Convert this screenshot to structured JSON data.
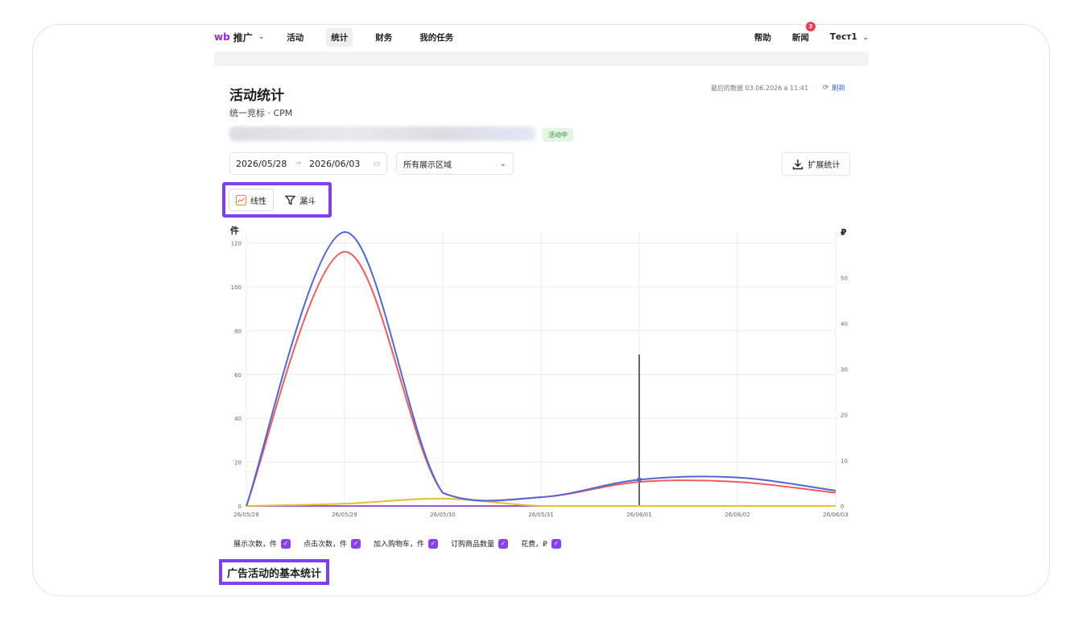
{
  "nav": {
    "logo": "wb",
    "product": "推广",
    "items": [
      "活动",
      "统计",
      "财务",
      "我的任务"
    ],
    "active_item": "统计",
    "help": "帮助",
    "news": "新闻",
    "news_badge": "3",
    "user": "Тест1"
  },
  "page": {
    "title": "活动统计",
    "subtitle": "统一竞标 · CPM",
    "updated": "最后的数据 03.06.2026 в 11:41",
    "refresh": "刷新",
    "status": "活动中"
  },
  "filters": {
    "date_from": "2026/05/28",
    "date_to": "2026/06/03",
    "region": "所有展示区域",
    "export": "扩展统计"
  },
  "view": {
    "linear": "线性",
    "funnel": "漏斗"
  },
  "chart_data": {
    "type": "line",
    "y_left_label": "件",
    "y_right_label": "₽",
    "x": [
      "26/05/28",
      "26/05/29",
      "26/05/30",
      "26/05/31",
      "26/06/01",
      "26/06/02",
      "26/06/03"
    ],
    "y_left_ticks": [
      0,
      20,
      40,
      60,
      80,
      100,
      120
    ],
    "y_right_ticks": [
      0,
      10,
      20,
      30,
      40,
      50
    ],
    "ylim_left": [
      0,
      125
    ],
    "ylim_right": [
      0,
      60
    ],
    "grid": true,
    "series": [
      {
        "name": "展示次数，件",
        "color": "#5068d8",
        "axis": "left",
        "values": [
          0,
          125,
          6,
          4,
          12,
          13,
          7
        ]
      },
      {
        "name": "点击次数，件",
        "color": "#ef5c5c",
        "axis": "left",
        "values": [
          0,
          116,
          6,
          4,
          11,
          11,
          6
        ]
      },
      {
        "name": "加入购物车，件",
        "color": "#2fb8a8",
        "axis": "left",
        "values": [
          0,
          0,
          0,
          0,
          0,
          0,
          0
        ]
      },
      {
        "name": "订购商品数量",
        "color": "#9b59d0",
        "axis": "left",
        "values": [
          0,
          0,
          0,
          0,
          0,
          0,
          0
        ]
      },
      {
        "name": "花费，₽",
        "color": "#e6c02e",
        "axis": "right",
        "values": [
          0,
          0.5,
          1.6,
          0,
          0,
          0,
          0
        ]
      }
    ],
    "cursor_x": "26/06/01"
  },
  "legend": [
    {
      "label": "展示次数，件"
    },
    {
      "label": "点击次数，件"
    },
    {
      "label": "加入购物车，件"
    },
    {
      "label": "订购商品数量"
    },
    {
      "label": "花费，₽"
    }
  ],
  "section": {
    "title": "广告活动的基本统计"
  },
  "colors": {
    "accent": "#7e3ff2",
    "brand": "#8b2bdc"
  }
}
